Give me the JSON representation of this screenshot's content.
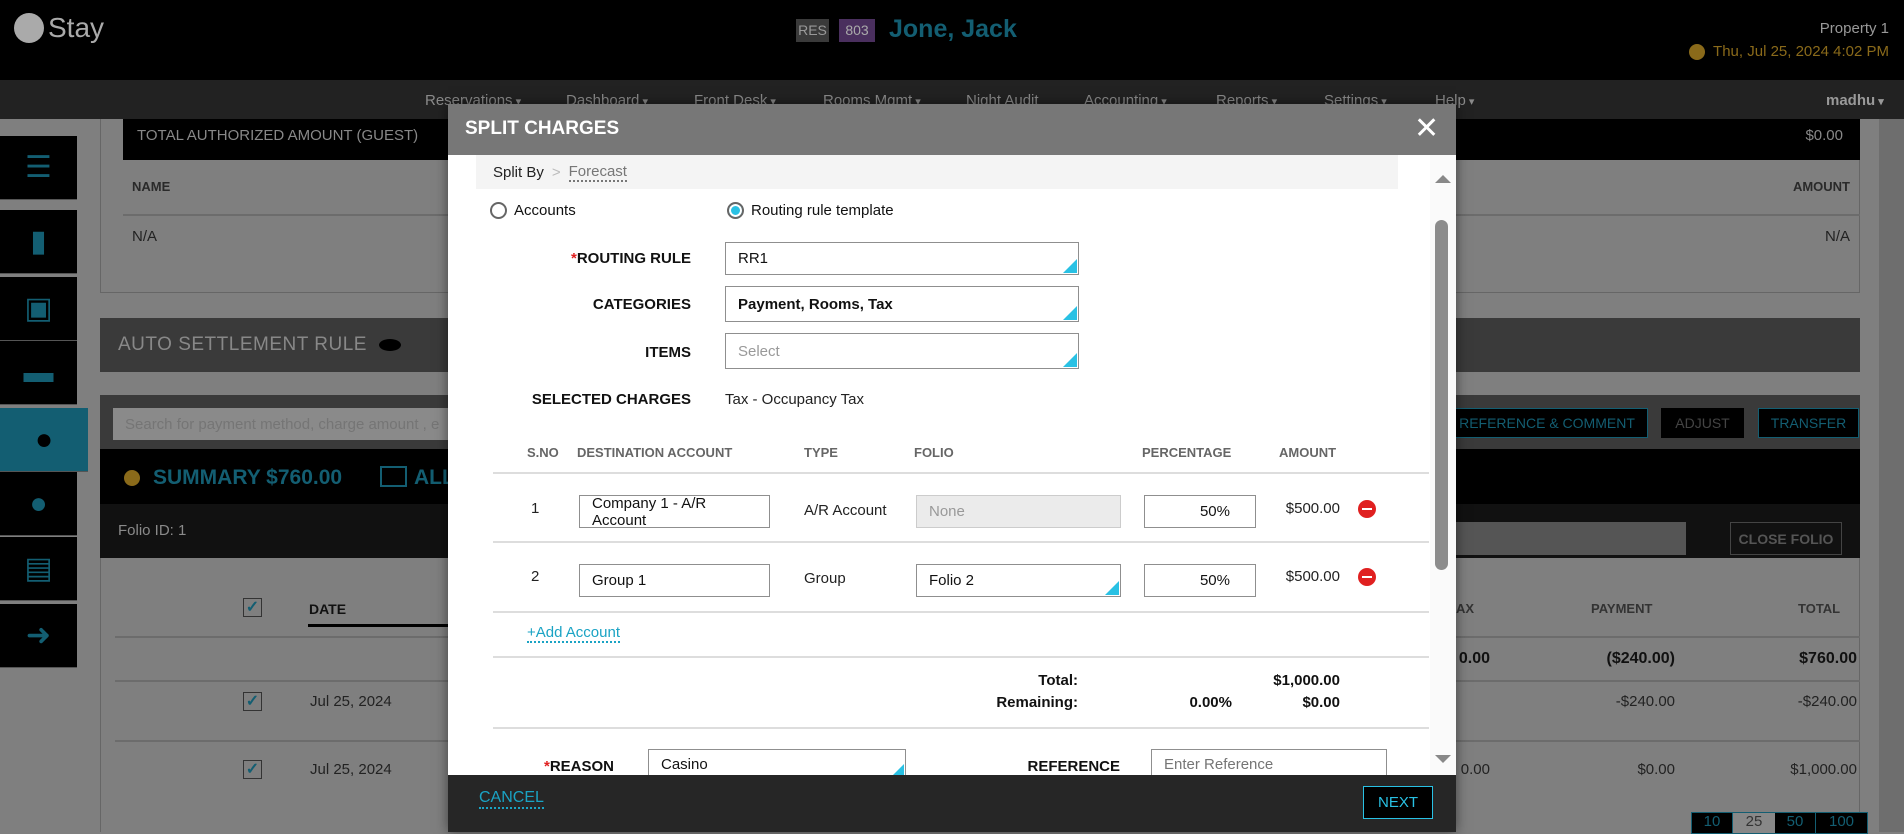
{
  "header": {
    "logo": "Stay",
    "badge_type": "RES",
    "room": "803",
    "guest_name": "Jone, Jack",
    "property": "Property 1",
    "datetime": "Thu, Jul 25, 2024 4:02 PM"
  },
  "nav": {
    "items": [
      "Reservations",
      "Dashboard",
      "Front Desk",
      "Rooms Mgmt",
      "Night Audit",
      "Accounting",
      "Reports",
      "Settings",
      "Help"
    ],
    "user": "madhu"
  },
  "sidebar": {
    "items": [
      "menu-icon",
      "chat-icon",
      "room-rate-icon",
      "bed-icon",
      "billing-icon",
      "guest-icon",
      "documents-icon",
      "checkout-icon"
    ],
    "active": "billing-icon"
  },
  "authorized": {
    "title": "TOTAL AUTHORIZED AMOUNT (GUEST)",
    "amount": "$0.00",
    "col_name": "NAME",
    "col_amount": "AMOUNT",
    "name": "N/A",
    "value": "N/A"
  },
  "auto_settlement": {
    "title": "AUTO SETTLEMENT RULE"
  },
  "toolbar": {
    "search_placeholder": "Search for payment method, charge amount , e",
    "reference_comment": "REFERENCE & COMMENT",
    "adjust": "ADJUST",
    "transfer": "TRANSFER"
  },
  "summary": {
    "label": "SUMMARY $760.00",
    "all": "ALL"
  },
  "folio": {
    "id_label": "Folio ID: 1",
    "close": "CLOSE FOLIO"
  },
  "table": {
    "headers": {
      "date": "DATE",
      "tax": "AX",
      "payment": "PAYMENT",
      "total": "TOTAL"
    },
    "summary_row": {
      "tax": "0.00",
      "payment": "($240.00)",
      "total": "$760.00"
    },
    "rows": [
      {
        "date": "Jul 25, 2024",
        "tax": "",
        "payment": "-$240.00",
        "total": "-$240.00"
      },
      {
        "date": "Jul 25, 2024",
        "tax": "0.00",
        "payment": "$0.00",
        "total": "$1,000.00"
      }
    ]
  },
  "pagination": [
    "10",
    "25",
    "50",
    "100"
  ],
  "modal": {
    "title": "SPLIT CHARGES",
    "breadcrumb": [
      "Split By",
      "Forecast"
    ],
    "radio_accounts": "Accounts",
    "radio_template": "Routing rule template",
    "selected_radio": "Routing rule template",
    "routing_rule_label": "ROUTING RULE",
    "routing_rule": "RR1",
    "categories_label": "CATEGORIES",
    "categories": "Payment, Rooms, Tax",
    "items_label": "ITEMS",
    "items_placeholder": "Select",
    "selected_charges_label": "SELECTED CHARGES",
    "selected_charges": "Tax - Occupancy Tax",
    "columns": [
      "S.NO",
      "DESTINATION ACCOUNT",
      "TYPE",
      "FOLIO",
      "PERCENTAGE",
      "AMOUNT"
    ],
    "rows": [
      {
        "sno": "1",
        "account": "Company 1 - A/R Account",
        "type": "A/R Account",
        "folio": "None",
        "percentage": "50%",
        "amount": "$500.00"
      },
      {
        "sno": "2",
        "account": "Group 1",
        "type": "Group",
        "folio": "Folio 2",
        "percentage": "50%",
        "amount": "$500.00"
      }
    ],
    "add_account": "+Add Account",
    "total_label": "Total:",
    "total_amount": "$1,000.00",
    "remaining_label": "Remaining:",
    "remaining_percent": "0.00%",
    "remaining_amount": "$0.00",
    "reason_label": "REASON",
    "reason": "Casino",
    "reference_label": "REFERENCE",
    "reference_placeholder": "Enter Reference",
    "cancel": "CANCEL",
    "next": "NEXT"
  },
  "colors": {
    "accent": "#29c1e4",
    "teal_dim": "#135e72",
    "required": "#e02020"
  }
}
